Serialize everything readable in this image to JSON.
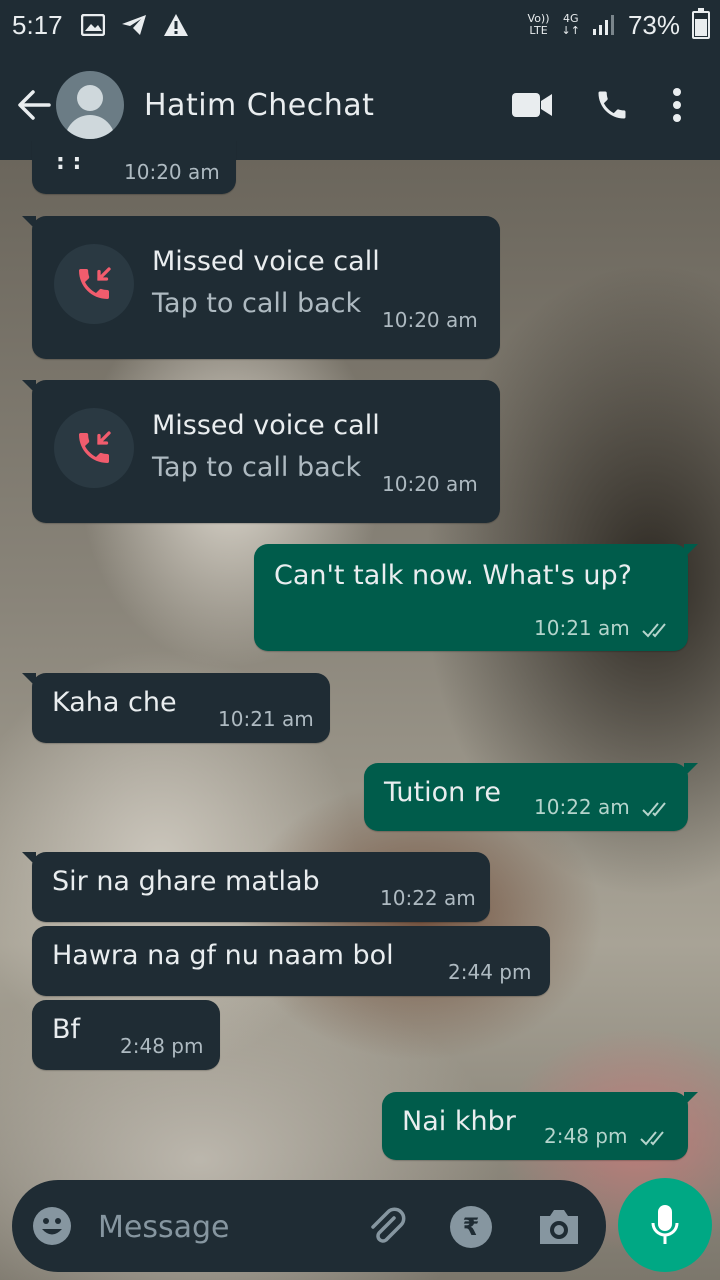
{
  "status_bar": {
    "time": "5:17",
    "network_volte": "Vo))",
    "network_lte": "LTE",
    "network_4g": "4G",
    "battery": "73%"
  },
  "header": {
    "contact_name": "Hatim Chechat"
  },
  "messages": [
    {
      "direction": "in",
      "type": "text",
      "text": ": :",
      "time": "10:20 am"
    },
    {
      "direction": "in",
      "type": "missed_call",
      "title": "Missed voice call",
      "subtitle": "Tap to call back",
      "time": "10:20 am"
    },
    {
      "direction": "in",
      "type": "missed_call",
      "title": "Missed voice call",
      "subtitle": "Tap to call back",
      "time": "10:20 am"
    },
    {
      "direction": "out",
      "type": "text",
      "text": "Can't talk now. What's up?",
      "time": "10:21 am"
    },
    {
      "direction": "in",
      "type": "text",
      "text": "Kaha che",
      "time": "10:21 am"
    },
    {
      "direction": "out",
      "type": "text",
      "text": "Tution re",
      "time": "10:22 am"
    },
    {
      "direction": "in",
      "type": "text",
      "text": "Sir na ghare matlab",
      "time": "10:22 am"
    },
    {
      "direction": "in",
      "type": "text",
      "text": "Hawra na gf nu naam bol",
      "time": "2:44 pm"
    },
    {
      "direction": "in",
      "type": "text",
      "text": "Bf",
      "time": "2:48 pm"
    },
    {
      "direction": "out",
      "type": "text",
      "text": "Nai khbr",
      "time": "2:48 pm"
    }
  ],
  "composer": {
    "placeholder": "Message",
    "pay_symbol": "₹"
  },
  "colors": {
    "bar": "#1f2c34",
    "incoming_bubble": "#1f2c34",
    "outgoing_bubble": "#005c4b",
    "accent": "#00a884",
    "missed_call_red": "#f15c6d",
    "read_ticks": "#b5d4cc"
  }
}
